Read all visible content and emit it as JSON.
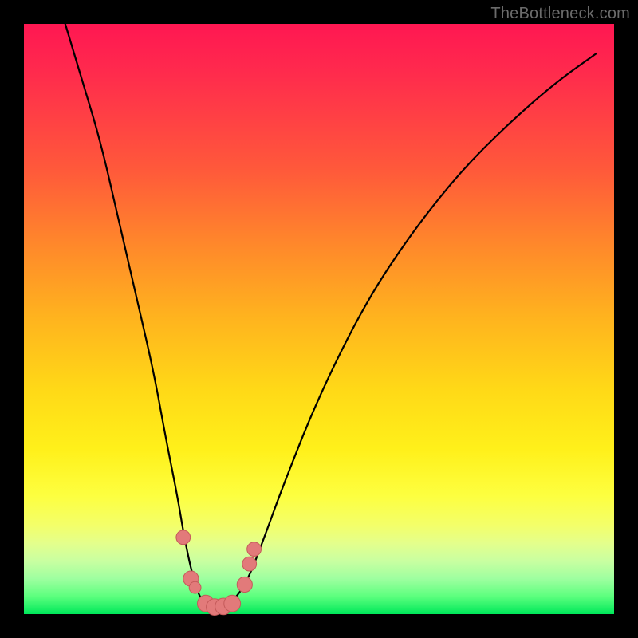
{
  "watermark": "TheBottleneck.com",
  "colors": {
    "gradient_top": "#ff1752",
    "gradient_mid": "#fff01a",
    "gradient_bottom": "#00e85a",
    "curve": "#000000",
    "marker_fill": "#e27a7a",
    "marker_stroke": "#c45a5a",
    "frame": "#000000"
  },
  "chart_data": {
    "type": "line",
    "title": "",
    "xlabel": "",
    "ylabel": "",
    "xlim": [
      0,
      100
    ],
    "ylim": [
      0,
      100
    ],
    "note": "Axes are unlabeled; x/y expressed as percent of plot width/height with y=0 at bottom. Curve resembles a bottleneck V-dip.",
    "series": [
      {
        "name": "bottleneck-curve",
        "x": [
          7,
          10,
          13,
          16,
          19,
          22,
          24,
          26,
          27,
          28,
          29,
          30,
          31,
          32.5,
          34,
          36,
          38,
          40,
          44,
          50,
          58,
          66,
          74,
          82,
          90,
          97
        ],
        "y": [
          100,
          90,
          80,
          67,
          54,
          41,
          30,
          20,
          14,
          9,
          5,
          2.5,
          1.3,
          1,
          1.3,
          2.8,
          6,
          11,
          22,
          37,
          53,
          65,
          75,
          83,
          90,
          95
        ]
      }
    ],
    "markers": {
      "name": "highlight-points",
      "note": "Salmon dots clustered around the dip of the curve.",
      "points": [
        {
          "x": 27.0,
          "y": 13.0,
          "r": 1.2
        },
        {
          "x": 28.3,
          "y": 6.0,
          "r": 1.3
        },
        {
          "x": 29.0,
          "y": 4.5,
          "r": 1.0
        },
        {
          "x": 30.8,
          "y": 1.8,
          "r": 1.4
        },
        {
          "x": 32.3,
          "y": 1.2,
          "r": 1.4
        },
        {
          "x": 33.8,
          "y": 1.3,
          "r": 1.4
        },
        {
          "x": 35.3,
          "y": 1.8,
          "r": 1.4
        },
        {
          "x": 37.4,
          "y": 5.0,
          "r": 1.3
        },
        {
          "x": 38.2,
          "y": 8.5,
          "r": 1.2
        },
        {
          "x": 39.0,
          "y": 11.0,
          "r": 1.2
        }
      ]
    }
  }
}
